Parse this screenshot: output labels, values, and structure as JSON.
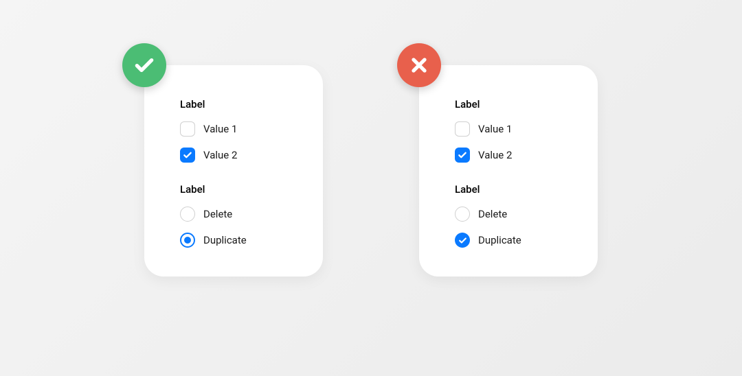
{
  "good": {
    "checkbox_group": {
      "label": "Label",
      "options": [
        {
          "label": "Value 1",
          "checked": false
        },
        {
          "label": "Value 2",
          "checked": true
        }
      ]
    },
    "radio_group": {
      "label": "Label",
      "options": [
        {
          "label": "Delete",
          "selected": false
        },
        {
          "label": "Duplicate",
          "selected": true
        }
      ]
    }
  },
  "bad": {
    "checkbox_group": {
      "label": "Label",
      "options": [
        {
          "label": "Value 1",
          "checked": false
        },
        {
          "label": "Value 2",
          "checked": true
        }
      ]
    },
    "radio_group": {
      "label": "Label",
      "options": [
        {
          "label": "Delete",
          "selected": false
        },
        {
          "label": "Duplicate",
          "selected": true
        }
      ]
    }
  },
  "colors": {
    "primary": "#0a7aff",
    "success": "#4bbd74",
    "error": "#e8604c"
  }
}
